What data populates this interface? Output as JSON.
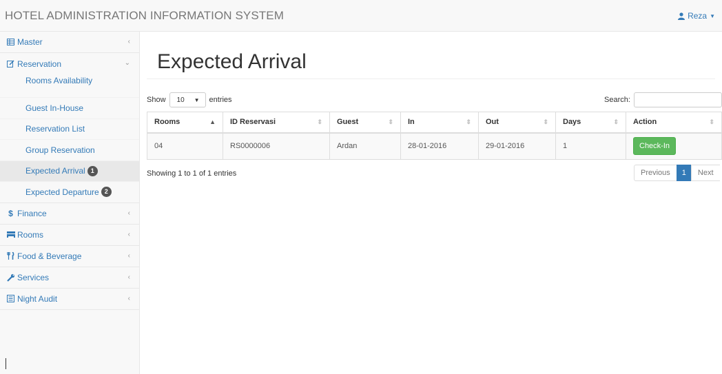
{
  "app": {
    "brand": "HOTEL ADMINISTRATION INFORMATION SYSTEM"
  },
  "user": {
    "name": "Reza"
  },
  "sidebar": {
    "master": "Master",
    "reservation": "Reservation",
    "reservation_items": [
      {
        "label": "Rooms Availability"
      },
      {
        "label": "Guest In-House"
      },
      {
        "label": "Reservation List"
      },
      {
        "label": "Group Reservation"
      },
      {
        "label": "Expected Arrival",
        "badge": "1"
      },
      {
        "label": "Expected Departure",
        "badge": "2"
      }
    ],
    "finance": "Finance",
    "rooms": "Rooms",
    "food_beverage": "Food & Beverage",
    "services": "Services",
    "night_audit": "Night Audit"
  },
  "main": {
    "title": "Expected Arrival",
    "show_label": "Show",
    "entries_value": "10",
    "entries_label": "entries",
    "search_label": "Search:",
    "search_value": "",
    "columns": [
      "Rooms",
      "ID Reservasi",
      "Guest",
      "In",
      "Out",
      "Days",
      "Action"
    ],
    "rows": [
      {
        "rooms": "04",
        "id": "RS0000006",
        "guest": "Ardan",
        "in": "28-01-2016",
        "out": "29-01-2016",
        "days": "1",
        "action": "Check-In"
      }
    ],
    "info": "Showing 1 to 1 of 1 entries",
    "pager": {
      "prev": "Previous",
      "current": "1",
      "next": "Next"
    }
  },
  "colors": {
    "link": "#337ab7",
    "success": "#5cb85c",
    "badge": "#555555"
  },
  "icons": {
    "master": "table-icon",
    "reservation": "edit-icon",
    "finance": "dollar-icon",
    "rooms": "bed-icon",
    "food": "cutlery-icon",
    "services": "wrench-icon",
    "night_audit": "list-alt-icon",
    "user": "user-icon"
  }
}
